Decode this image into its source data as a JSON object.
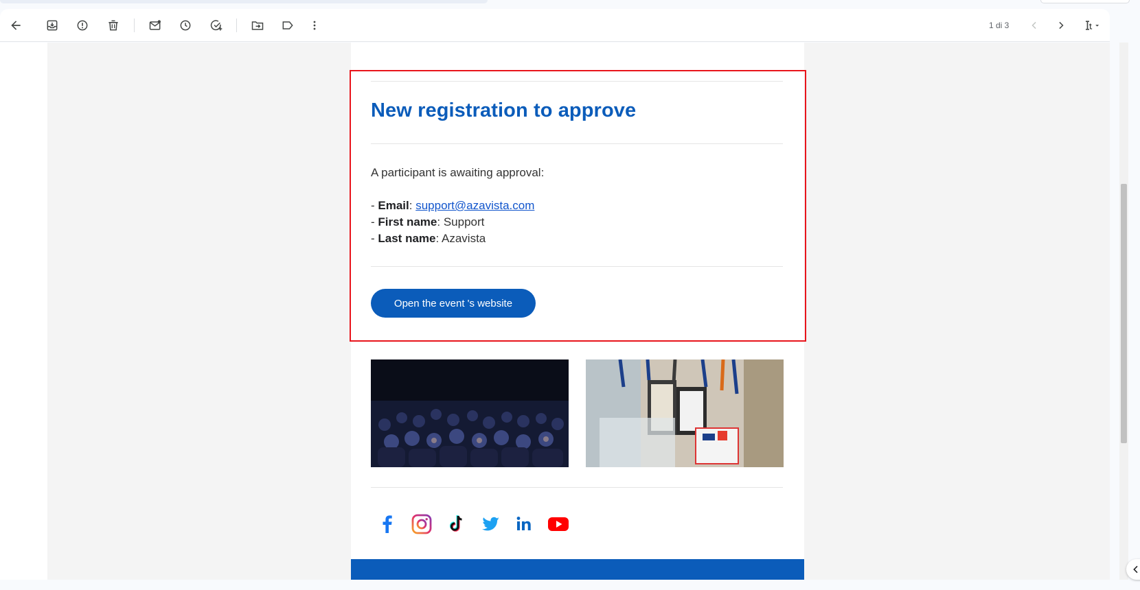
{
  "toolbar": {
    "buttons": [
      {
        "name": "back",
        "icon": "arrow-left-icon"
      },
      {
        "name": "archive",
        "icon": "archive-icon"
      },
      {
        "name": "report-spam",
        "icon": "report-icon"
      },
      {
        "name": "delete",
        "icon": "trash-icon"
      },
      {
        "name": "mark-unread",
        "icon": "mail-unread-icon"
      },
      {
        "name": "snooze",
        "icon": "clock-icon"
      },
      {
        "name": "add-task",
        "icon": "add-task-icon"
      },
      {
        "name": "move-to",
        "icon": "folder-move-icon"
      },
      {
        "name": "label",
        "icon": "label-icon"
      },
      {
        "name": "more",
        "icon": "more-vert-icon"
      }
    ],
    "pager": "1 di 3",
    "input_tools_icon": "input-tools-icon"
  },
  "email": {
    "title": "New registration to approve",
    "intro": "A participant is awaiting approval:",
    "fields": [
      {
        "prefix": "- ",
        "label": "Email",
        "sep": ": ",
        "value": "support@azavista.com",
        "is_link": true
      },
      {
        "prefix": "- ",
        "label": "First name",
        "sep": ": ",
        "value": "Support",
        "is_link": false
      },
      {
        "prefix": "- ",
        "label": "Last name",
        "sep": ": ",
        "value": "Azavista",
        "is_link": false
      }
    ],
    "cta_label": "Open the event 's website",
    "photos": [
      "audience-photo",
      "name-badges-photo"
    ],
    "social": [
      "facebook-icon",
      "instagram-icon",
      "tiktok-icon",
      "twitter-icon",
      "linkedin-icon",
      "youtube-icon"
    ]
  },
  "colors": {
    "brand_blue": "#0b5cba",
    "highlight_red": "#e8141b",
    "link_blue": "#1155cc"
  }
}
